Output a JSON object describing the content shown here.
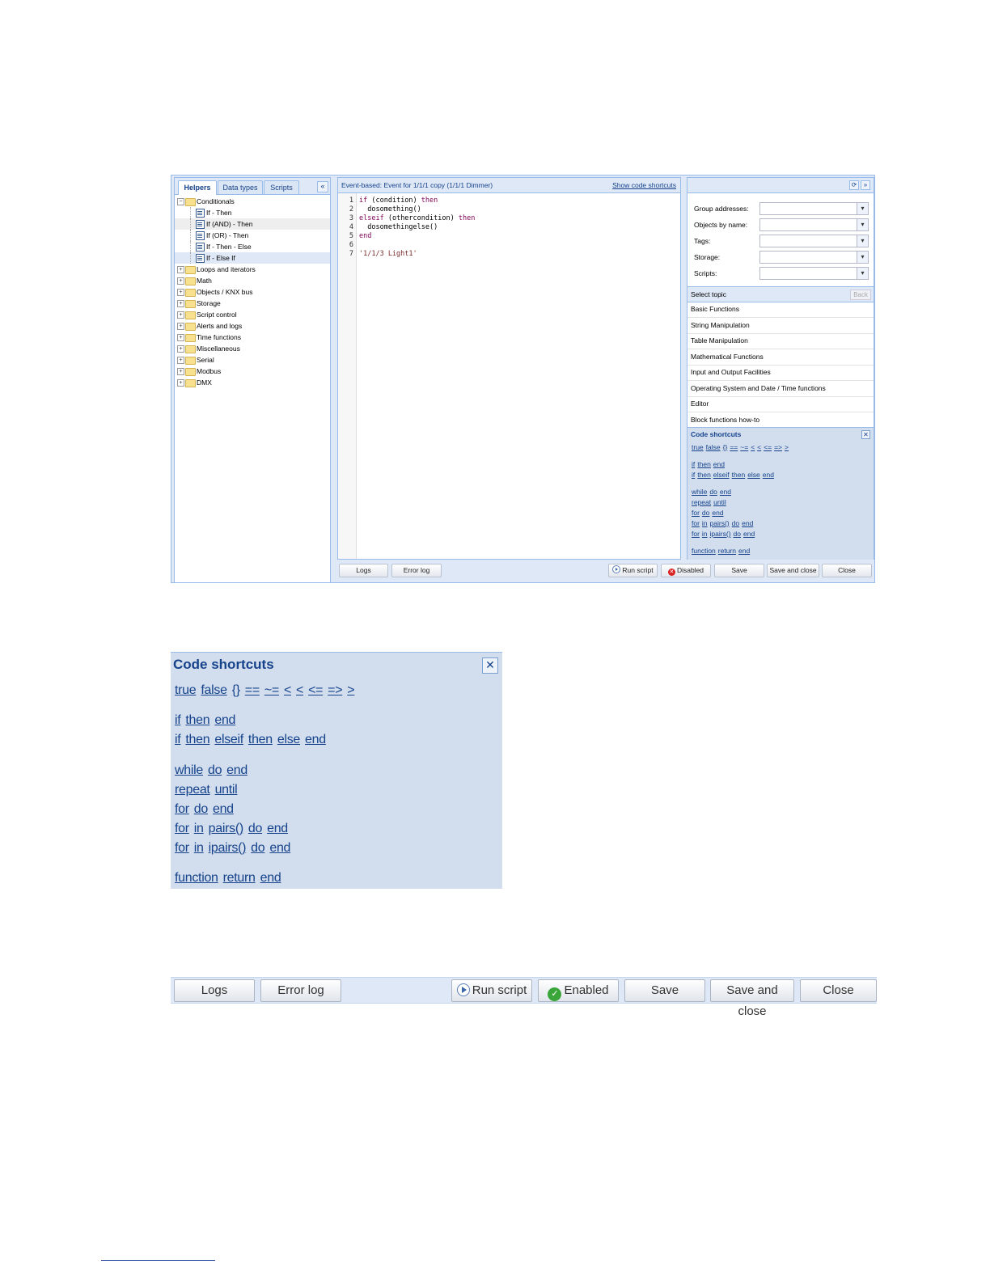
{
  "left_panel": {
    "tabs": [
      "Helpers",
      "Data types",
      "Scripts"
    ],
    "collapse_icon": "double-chevron-left-icon",
    "tree": [
      {
        "label": "Conditionals",
        "expanded": true,
        "children": [
          "If - Then",
          "If (AND) - Then",
          "If (OR) - Then",
          "If - Then - Else",
          "If - Else If"
        ]
      },
      {
        "label": "Loops and iterators"
      },
      {
        "label": "Math"
      },
      {
        "label": "Objects / KNX bus"
      },
      {
        "label": "Storage"
      },
      {
        "label": "Script control"
      },
      {
        "label": "Alerts and logs"
      },
      {
        "label": "Time functions"
      },
      {
        "label": "Miscellaneous"
      },
      {
        "label": "Serial"
      },
      {
        "label": "Modbus"
      },
      {
        "label": "DMX"
      }
    ]
  },
  "editor": {
    "title": "Event-based: Event for 1/1/1 copy (1/1/1 Dimmer)",
    "show_shortcuts": "Show code shortcuts",
    "line_numbers": [
      "1",
      "2",
      "3",
      "4",
      "5",
      "6",
      "7"
    ],
    "code": {
      "l1_kw1": "if",
      "l1_mid": " (condition) ",
      "l1_kw2": "then",
      "l2": "  dosomething()",
      "l3_kw1": "elseif",
      "l3_mid": " (othercondition) ",
      "l3_kw2": "then",
      "l4": "  dosomethingelse()",
      "l5_kw": "end",
      "l7_str": "'1/1/3 Light1'"
    }
  },
  "right_panel": {
    "icons": [
      "refresh-icon",
      "double-chevron-right-icon"
    ],
    "filters": [
      "Group addresses:",
      "Objects by name:",
      "Tags:",
      "Storage:",
      "Scripts:"
    ],
    "select_topic": "Select topic",
    "back": "Back",
    "topics": [
      "Basic Functions",
      "String Manipulation",
      "Table Manipulation",
      "Mathematical Functions",
      "Input and Output Facilities",
      "Operating System and Date / Time functions",
      "Editor",
      "Block functions how-to"
    ]
  },
  "code_shortcuts": {
    "title": "Code shortcuts",
    "close_icon": "close-icon",
    "lines": [
      [
        "true",
        "false",
        "{}",
        "==",
        "~=",
        "<",
        "<",
        "<=",
        "=>",
        ">"
      ],
      [
        "if",
        "then",
        "end"
      ],
      [
        "if",
        "then",
        "elseif",
        "then",
        "else",
        "end"
      ],
      [
        "while",
        "do",
        "end"
      ],
      [
        "repeat",
        "until"
      ],
      [
        "for",
        "do",
        "end"
      ],
      [
        "for",
        "in",
        "pairs()",
        "do",
        "end"
      ],
      [
        "for",
        "in",
        "ipairs()",
        "do",
        "end"
      ],
      [
        "function",
        "return",
        "end"
      ]
    ]
  },
  "bottom_bar": {
    "logs": "Logs",
    "error_log": "Error log",
    "run_script": "Run script",
    "disabled": "Disabled",
    "save": "Save",
    "save_and_close": "Save and close",
    "close": "Close"
  },
  "zoom_bar": {
    "logs": "Logs",
    "error_log": "Error log",
    "run_script": "Run script",
    "enabled": "Enabled",
    "save": "Save",
    "save_and_close": "Save and close",
    "close": "Close"
  }
}
